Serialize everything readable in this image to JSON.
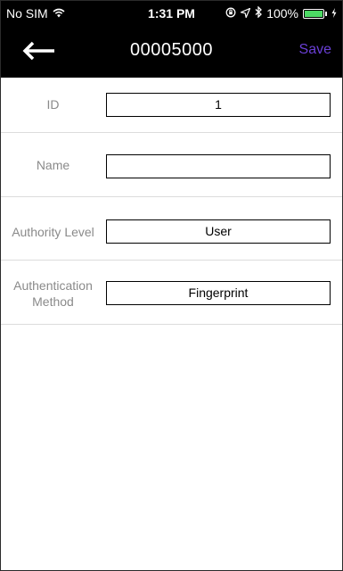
{
  "status_bar": {
    "carrier": "No SIM",
    "time": "1:31 PM",
    "battery": "100%"
  },
  "nav": {
    "title": "00005000",
    "save_label": "Save"
  },
  "form": {
    "id": {
      "label": "ID",
      "value": "1"
    },
    "name": {
      "label": "Name",
      "value": ""
    },
    "authority_level": {
      "label": "Authority Level",
      "value": "User"
    },
    "authentication_method": {
      "label_line1": "Authentication",
      "label_line2": "Method",
      "value": "Fingerprint"
    }
  }
}
